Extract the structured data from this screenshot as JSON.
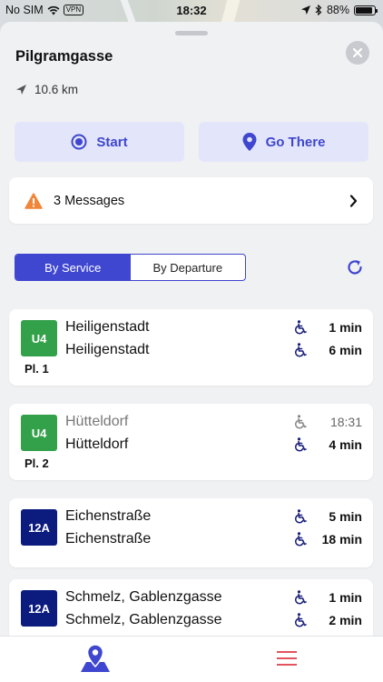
{
  "status_bar": {
    "carrier": "No SIM",
    "vpn": "VPN",
    "time": "18:32",
    "battery": "88%",
    "battery_level": 0.88
  },
  "sheet": {
    "title": "Pilgramgasse",
    "distance": "10.6 km"
  },
  "actions": {
    "start_label": "Start",
    "go_label": "Go There"
  },
  "messages": {
    "label": "3 Messages"
  },
  "segmented": {
    "by_service": "By Service",
    "by_departure": "By Departure",
    "active": "By Service"
  },
  "colors": {
    "accent": "#3f46cf",
    "u4": "#33a04a",
    "bus": "#0b1b7e",
    "warning": "#f0863a",
    "close": "#c9cacf"
  },
  "cards": [
    {
      "line": "U4",
      "line_color": "#33a04a",
      "platform": "Pl. 1",
      "departures": [
        {
          "destination": "Heiligenstadt",
          "time": "1 min",
          "past": false
        },
        {
          "destination": "Heiligenstadt",
          "time": "6 min",
          "past": false
        }
      ]
    },
    {
      "line": "U4",
      "line_color": "#33a04a",
      "platform": "Pl. 2",
      "departures": [
        {
          "destination": "Hütteldorf",
          "time": "18:31",
          "past": true
        },
        {
          "destination": "Hütteldorf",
          "time": "4 min",
          "past": false
        }
      ]
    },
    {
      "line": "12A",
      "line_color": "#0b1b7e",
      "platform": "",
      "departures": [
        {
          "destination": "Eichenstraße",
          "time": "5 min",
          "past": false
        },
        {
          "destination": "Eichenstraße",
          "time": "18 min",
          "past": false
        }
      ]
    },
    {
      "line": "12A",
      "line_color": "#0b1b7e",
      "platform": "",
      "departures": [
        {
          "destination": "Schmelz, Gablenzgasse",
          "time": "1 min",
          "past": false
        },
        {
          "destination": "Schmelz, Gablenzgasse",
          "time": "2 min",
          "past": false
        }
      ]
    }
  ],
  "icons": {
    "close": "close-icon",
    "distance": "navigation-arrow-icon",
    "start": "target-icon",
    "go": "location-pin-icon",
    "warning": "warning-triangle-icon",
    "chevron": "chevron-right-icon",
    "refresh": "refresh-icon",
    "wheelchair": "wheelchair-icon",
    "tab_map": "map-pin-tab-icon",
    "tab_menu": "hamburger-menu-icon"
  }
}
